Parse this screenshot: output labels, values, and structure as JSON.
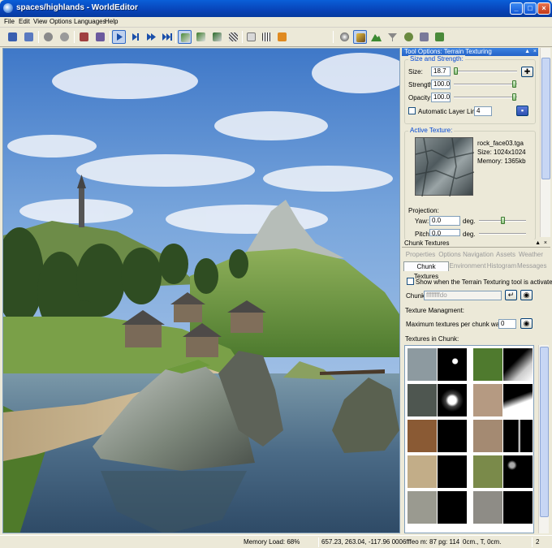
{
  "window": {
    "title": "spaces/highlands - WorldEditor"
  },
  "menu": [
    "File",
    "Edit",
    "View",
    "Options",
    "Languages",
    "Help"
  ],
  "toolbar": {
    "icons": [
      "save-icon",
      "save-all-icon",
      "undo-icon",
      "redo-icon",
      "print-icon",
      "walker-icon",
      "play-icon",
      "step-icon",
      "fast-forward-icon",
      "fast-forward-end-icon",
      "terrain-texture-tool-icon",
      "terrain-height-tool-icon",
      "terrain-filter-tool-icon",
      "terrain-mesh-tool-icon",
      "chunk-export-icon",
      "chunk-grid-icon",
      "home-icon",
      "globe-icon",
      "brush-icon",
      "mountain-icon",
      "funnel-icon",
      "scissors-icon",
      "group-icon",
      "chunk-tree-icon"
    ]
  },
  "tool_options": {
    "title": "Tool Options: Terrain Texturing",
    "size_strength_group": "Size and Strength:",
    "size_label": "Size:",
    "size_value": "18.7",
    "strength_label": "Strength:",
    "strength_value": "100.0",
    "opacity_label": "Opacity:",
    "opacity_value": "100.0",
    "auto_layer_label": "Automatic Layer Limit:",
    "auto_layer_value": "4",
    "size_level": 0.0,
    "strength_level": 1.0,
    "opacity_level": 1.0,
    "active_texture_group": "Active Texture:",
    "texture_name": "rock_face03.tga",
    "texture_size": "Size: 1024x1024",
    "texture_memory": "Memory: 1365kb",
    "projection_label": "Projection:",
    "yaw_label": "Yaw:",
    "yaw_value": "0.0",
    "yaw_unit": "deg.",
    "pitch_label": "Pitch:",
    "pitch_value": "0.0",
    "pitch_unit": "deg."
  },
  "chunk_textures": {
    "title": "Chunk Textures",
    "tabs_row1": [
      "Properties",
      "Options",
      "Navigation",
      "Assets",
      "Weather"
    ],
    "tabs_row2": [
      "Chunk Textures",
      "Environment",
      "Histogram",
      "Messages"
    ],
    "selected_tab": "Chunk Textures",
    "show_when_label": "Show when the Terrain Texturing tool is activated",
    "chunk_label": "Chunk:",
    "chunk_value": "ffffffffdo",
    "texture_mgmt_label": "Texture Managment:",
    "max_textures_label": "Maximum textures per chunk warning:",
    "max_textures_value": "0",
    "textures_in_chunk_label": "Textures in Chunk:"
  },
  "status": {
    "memory_load": "Memory Load: 68%",
    "coords": "657.23, 263.04, -117.96 0006fffeo m: 87 pg: 114",
    "grid": "0cm., T, 0cm.",
    "count": "2"
  },
  "colors": {
    "accent": "#316ac5",
    "titlebar": "#0843b8",
    "group_title": "#0046d5"
  }
}
